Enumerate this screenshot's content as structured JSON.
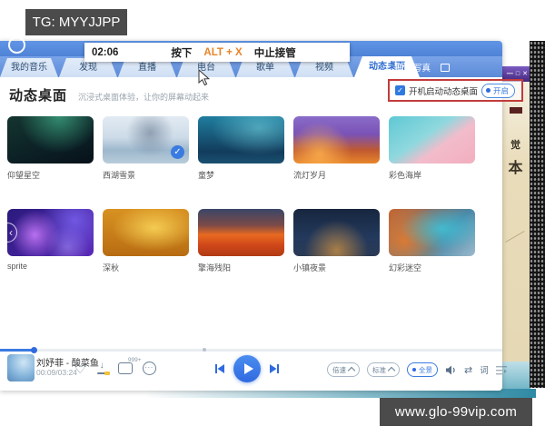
{
  "colors": {
    "accent_blue": "#3a7be0",
    "hotkey_orange": "#e8842a",
    "annotation_red": "#c23b3b",
    "overlay_gray": "#4b4b4b",
    "header_blue": "#5b8ad8"
  },
  "overlays": {
    "tg_label": "TG: MYYJJPP",
    "url_label": "www.glo-99vip.com"
  },
  "takeover_bar": {
    "time": "02:06",
    "press_label": "按下",
    "hotkey": "ALT + X",
    "stop_label": "中止接管"
  },
  "tabs": [
    {
      "label": "我的音乐",
      "active": false
    },
    {
      "label": "发现",
      "active": false
    },
    {
      "label": "直播",
      "active": false
    },
    {
      "label": "电台",
      "active": false
    },
    {
      "label": "歌单",
      "active": false
    },
    {
      "label": "视频",
      "active": false
    },
    {
      "label": "动态桌面",
      "active": true
    }
  ],
  "header_right": {
    "lyrics_photo_label": "歌词写真"
  },
  "page": {
    "title": "动态桌面",
    "subtitle": "沉浸式桌面体验，让你的屏幕动起来",
    "autostart_label": "开机启动动态桌面",
    "autostart_checked": true,
    "toggle_label": "开启"
  },
  "wallpapers": [
    {
      "name": "仰望星空",
      "selected": false,
      "nav": false,
      "bg": "radial-gradient(ellipse at 60% 0%, rgba(80,220,170,0.55), transparent 55%), linear-gradient(160deg, #143530, #0a1c22 70%, #071018)"
    },
    {
      "name": "西湖雪景",
      "selected": true,
      "nav": false,
      "bg": "radial-gradient(circle at 55% 35%, rgba(90,110,135,0.55), transparent 42%), linear-gradient(180deg, #e2ebf3 0%, #cddbe8 45%, #9db7cc 72%, #b9cdda 100%)"
    },
    {
      "name": "童梦",
      "selected": false,
      "nav": false,
      "bg": "radial-gradient(ellipse at 70% 25%, rgba(130,225,235,0.5), transparent 55%), linear-gradient(180deg, #1f7d9e, #123c5c 75%, #1a5070)"
    },
    {
      "name": "流灯岁月",
      "selected": false,
      "nav": false,
      "bg": "radial-gradient(circle at 30% 80%, rgba(255,180,80,0.8), transparent 45%), linear-gradient(180deg, #8a6cc8 0%, #7a52b6 38%, #c05a30 72%, #e8862a 100%)"
    },
    {
      "name": "彩色海岸",
      "selected": false,
      "nav": false,
      "bg": "linear-gradient(145deg, #5ec8d4 0%, #8fd8de 42%, #f2bccb 62%, #f2aebe 100%)"
    },
    {
      "name": "sprite",
      "selected": false,
      "nav": true,
      "bg": "radial-gradient(circle at 32% 55%, rgba(205,125,255,0.85), transparent 38%), radial-gradient(circle at 78% 25%, rgba(130,110,255,0.7), transparent 45%), radial-gradient(circle at 70% 80%, rgba(180,160,255,0.5), transparent 30%), linear-gradient(135deg, #2a1a7c, #5a2ab8)"
    },
    {
      "name": "深秋",
      "selected": false,
      "nav": false,
      "bg": "radial-gradient(ellipse at 60% 40%, rgba(255,222,95,0.8), transparent 58%), linear-gradient(180deg, #d89222, #b86c12)"
    },
    {
      "name": "擎海残阳",
      "selected": false,
      "nav": false,
      "bg": "linear-gradient(180deg, #3a4668 0%, #7a4a48 34%, #e86a20 55%, #d0481a 76%, #b03a14 100%)"
    },
    {
      "name": "小镇夜景",
      "selected": false,
      "nav": false,
      "bg": "radial-gradient(ellipse at 50% 88%, rgba(255,172,62,0.6), transparent 52%), linear-gradient(180deg, #17263f, #23395c 60%, #2a3a55 100%)"
    },
    {
      "name": "幻彩迷空",
      "selected": false,
      "nav": false,
      "bg": "radial-gradient(ellipse at 62% 42%, rgba(64,195,215,0.85), transparent 55%), radial-gradient(circle at 18% 68%, rgba(232,122,42,0.85), transparent 52%), linear-gradient(135deg, #c06030, #4a88a8 62%, #9cbacc)"
    }
  ],
  "player": {
    "song": "刘妤菲 - 酸菜鱼",
    "time": "00:09/03:24",
    "comment_count": "999+",
    "speed_label": "倍速",
    "quality_label": "标准",
    "panorama_label": "全景",
    "lyrics_label": "词"
  },
  "side_window": {
    "fragment1": "觉",
    "fragment2": "本"
  },
  "icons": {
    "check": "✓",
    "nav_prev": "‹",
    "heart": "♡",
    "shuffle": "⇄",
    "more": "···",
    "hamburger": "☰",
    "minimize": "—",
    "maximize": "□",
    "close": "✕"
  }
}
